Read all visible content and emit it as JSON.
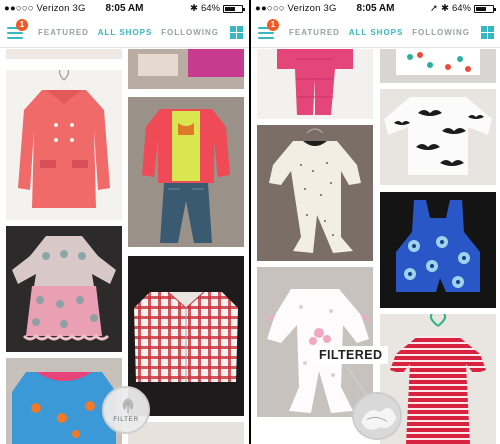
{
  "status_bar": {
    "carrier": "●●○○○ Verizon  3G",
    "time": "8:05 AM",
    "battery": "64%",
    "battery_fraction": 0.64
  },
  "nav": {
    "badge_count": "1",
    "tabs": [
      {
        "label": "FEATURED",
        "active": false
      },
      {
        "label": "ALL SHOPS",
        "active": true
      },
      {
        "label": "FOLLOWING",
        "active": false
      }
    ]
  },
  "filter_button": {
    "label": "FILTER"
  },
  "callout": {
    "label": "FILTERED"
  },
  "colors": {
    "accent": "#36b7c2",
    "badge": "#f05a28",
    "inactive_tab": "#9aa0a3"
  },
  "icons": [
    "hamburger-menu-icon",
    "grid-view-icon",
    "leaf-icon",
    "bluetooth-icon",
    "location-arrow-icon",
    "battery-icon"
  ]
}
